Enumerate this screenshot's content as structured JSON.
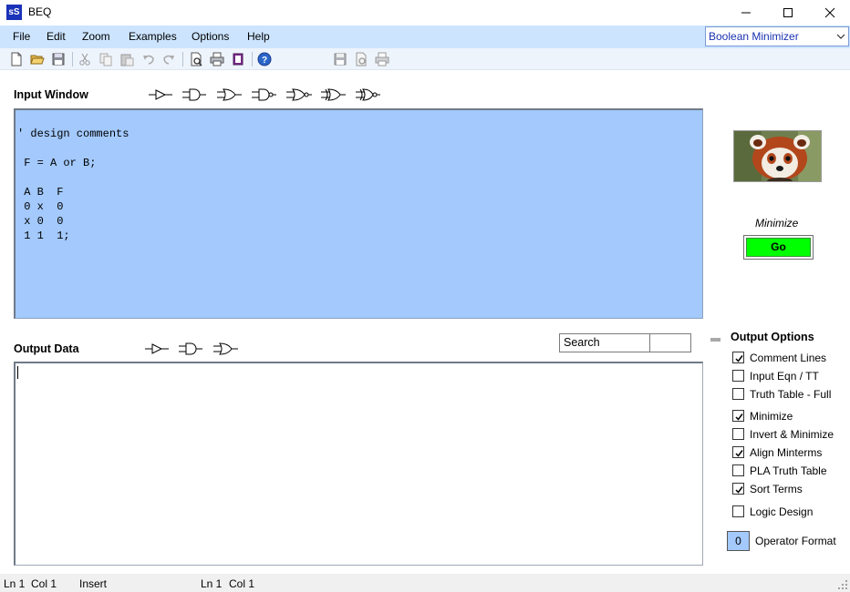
{
  "window": {
    "app_icon_text": "sS",
    "title": "BEQ"
  },
  "menu": {
    "items": [
      "File",
      "Edit",
      "Zoom",
      "Examples",
      "Options",
      "Help"
    ],
    "mode_select": "Boolean Minimizer"
  },
  "toolbar": {
    "icons": [
      "new-file-icon",
      "open-folder-icon",
      "save-icon",
      "cut-icon",
      "copy-icon",
      "paste-icon",
      "undo-icon",
      "redo-icon",
      "print-preview-icon",
      "print-icon",
      "book-icon",
      "help-icon",
      "save-output-icon",
      "output-preview-icon",
      "output-print-icon"
    ]
  },
  "input": {
    "label": "Input Window",
    "text": "' design comments\n\n F = A or B;\n\n A B  F\n 0 x  0\n x 0  0\n 1 1  1;",
    "gates": [
      "buffer-gate-icon",
      "and-gate-icon",
      "or-gate-icon",
      "nand-gate-icon",
      "nor-gate-icon",
      "xor-gate-icon",
      "xnor-gate-icon"
    ]
  },
  "output": {
    "label": "Output Data",
    "text": "",
    "gates": [
      "buffer-gate-icon",
      "and-gate-icon",
      "or-gate-icon"
    ],
    "search_label": "Search",
    "search_value": ""
  },
  "side": {
    "image": "red-panda-image",
    "minimize_label": "Minimize",
    "go_label": "Go",
    "go_color": "#00ff00"
  },
  "options": {
    "title": "Output Options",
    "items": [
      {
        "label": "Comment Lines",
        "checked": true
      },
      {
        "label": "Input Eqn / TT",
        "checked": false
      },
      {
        "label": "Truth Table - Full",
        "checked": false
      },
      {
        "label": "Minimize",
        "checked": true
      },
      {
        "label": "Invert & Minimize",
        "checked": false
      },
      {
        "label": "Align Minterms",
        "checked": true
      },
      {
        "label": "PLA Truth Table",
        "checked": false
      },
      {
        "label": "Sort Terms",
        "checked": true
      },
      {
        "label": "Logic Design",
        "checked": false
      }
    ],
    "operator_format_value": "0",
    "operator_format_label": "Operator Format"
  },
  "status": {
    "left_ln": "Ln 1",
    "left_col": "Col 1",
    "mode": "Insert",
    "right_ln": "Ln 1",
    "right_col": "Col 1"
  },
  "colors": {
    "menubar": "#cce4fe",
    "input_bg": "#a3c9fd",
    "title_accent": "#1a32b0"
  }
}
